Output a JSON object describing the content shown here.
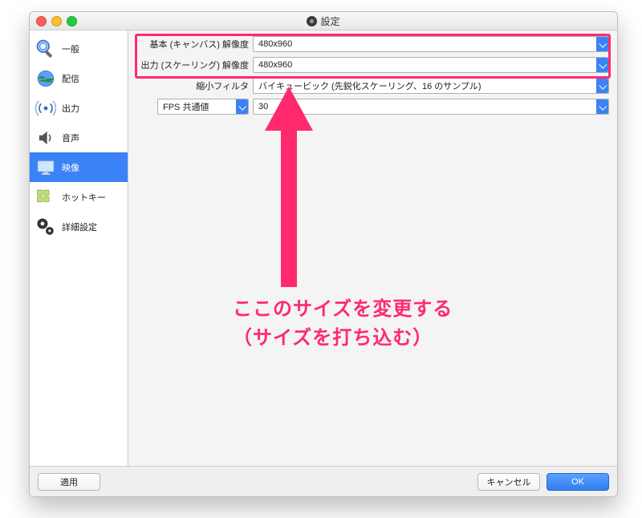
{
  "window": {
    "title": "設定"
  },
  "sidebar": {
    "items": [
      {
        "label": "一般"
      },
      {
        "label": "配信"
      },
      {
        "label": "出力"
      },
      {
        "label": "音声"
      },
      {
        "label": "映像"
      },
      {
        "label": "ホットキー"
      },
      {
        "label": "詳細設定"
      }
    ]
  },
  "form": {
    "base_label": "基本 (キャンバス) 解像度",
    "base_value": "480x960",
    "output_label": "出力 (スケーリング) 解像度",
    "output_value": "480x960",
    "filter_label": "縮小フィルタ",
    "filter_value": "バイキュービック (先鋭化スケーリング、16 のサンプル)",
    "fps_type_label": "FPS 共通値",
    "fps_value": "30"
  },
  "annotation": {
    "line1": "ここのサイズを変更する",
    "line2": "（サイズを打ち込む）"
  },
  "buttons": {
    "apply": "適用",
    "cancel": "キャンセル",
    "ok": "OK"
  }
}
